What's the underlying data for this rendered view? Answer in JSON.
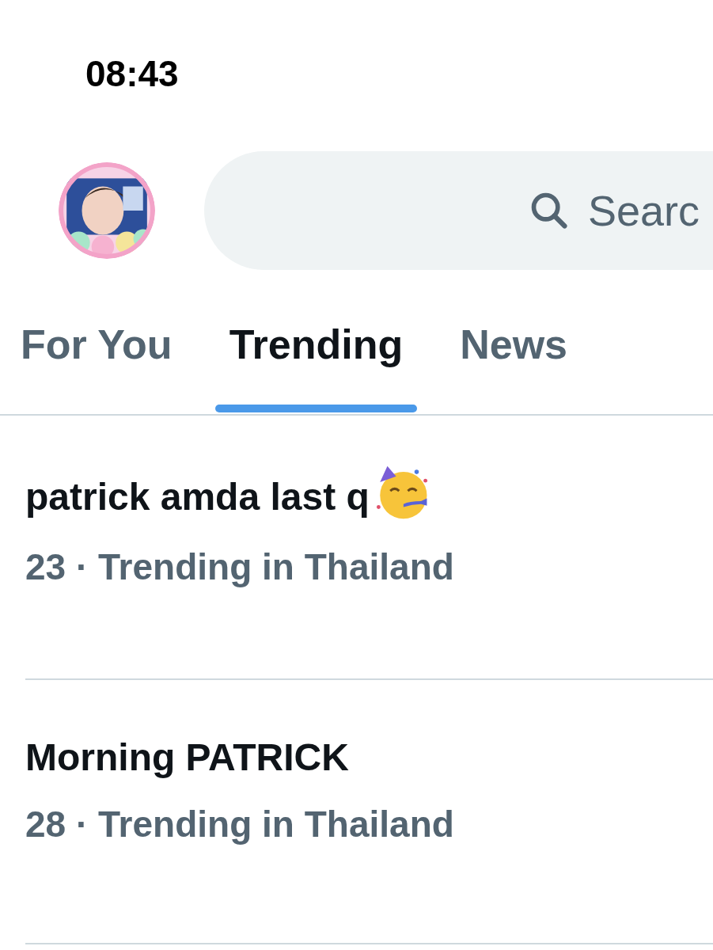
{
  "status_bar": {
    "time": "08:43"
  },
  "header": {
    "search": {
      "placeholder": "Searc"
    }
  },
  "tabs": [
    {
      "label": "For You",
      "selected": false
    },
    {
      "label": "Trending",
      "selected": true
    },
    {
      "label": "News",
      "selected": false
    }
  ],
  "trends": [
    {
      "title": "patrick amda last q",
      "emoji": true,
      "meta": "23 · Trending in Thailand"
    },
    {
      "title": "Morning PATRICK",
      "emoji": false,
      "meta": "28 · Trending in Thailand"
    }
  ]
}
